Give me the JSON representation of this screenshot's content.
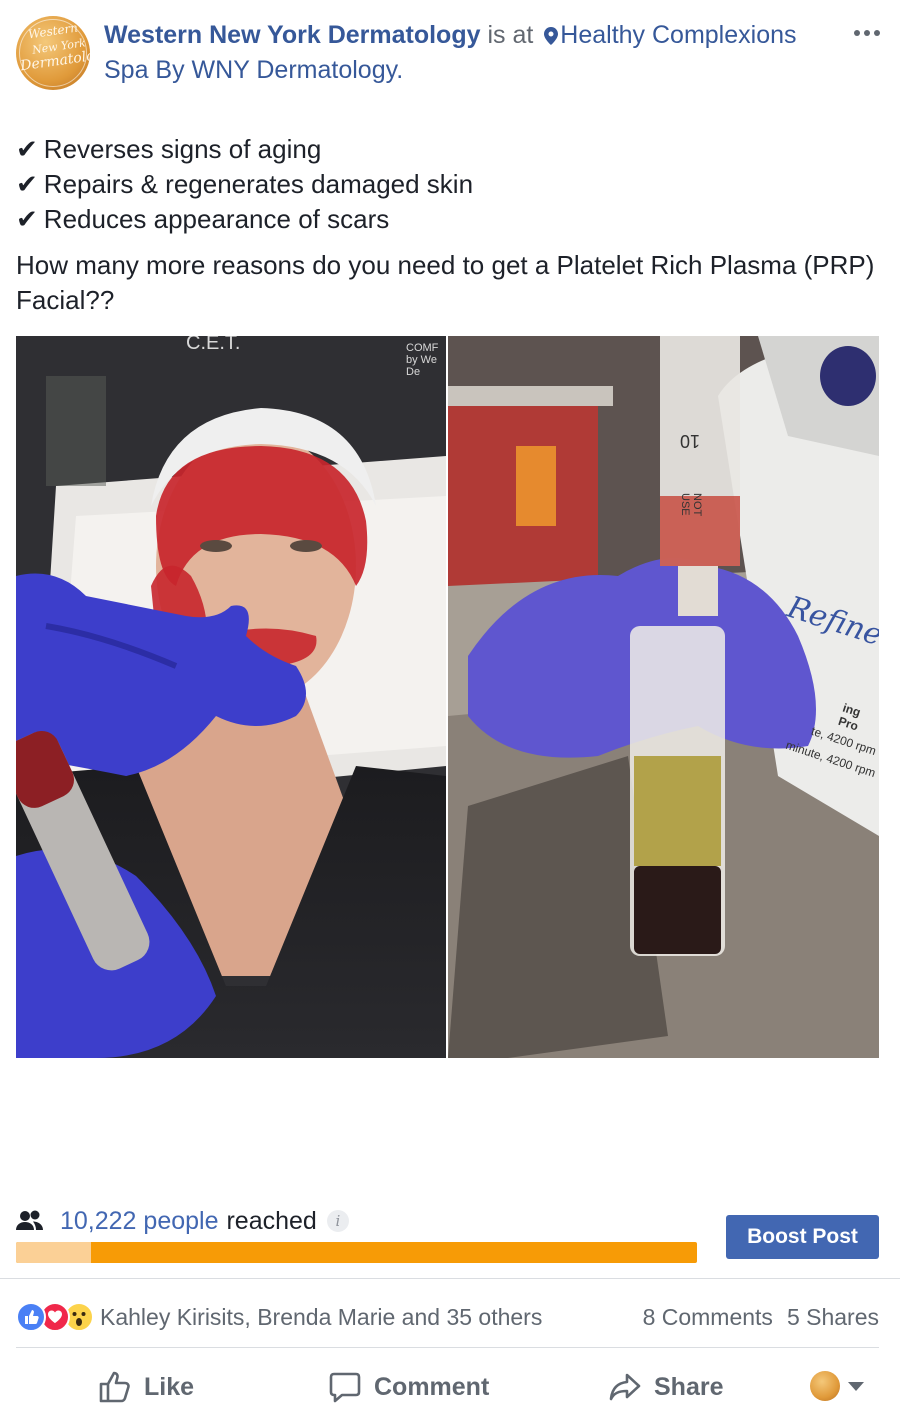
{
  "header": {
    "page_name": "Western New York Dermatology",
    "is_at": "is at",
    "location": "Healthy Complexions Spa By WNY Dermatology.",
    "avatar_text": [
      "Western",
      "New York",
      "Dermatology"
    ]
  },
  "post": {
    "check_mark": "✔",
    "bullets": [
      "Reverses signs of aging",
      "Repairs & regenerates damaged skin",
      "Reduces appearance of scars"
    ],
    "question": "How many more reasons do you need to get a Platelet Rich Plasma (PRP) Facial??"
  },
  "photos": {
    "left": {
      "cap_text": "C.E.T.",
      "scrub_logo": "COMF by We De"
    },
    "right": {
      "syringe_mark": "10",
      "syringe_text": "NOT USE",
      "centrifuge_brand": "Refine",
      "centrifuge_lines": [
        "ing Pro",
        "te, 4200 rpm",
        "minute, 4200 rpm"
      ]
    }
  },
  "insights": {
    "reach_count": "10,222 people",
    "reach_label": "reached",
    "info": "i",
    "reach_bar_fraction": 0.11,
    "boost_label": "Boost Post"
  },
  "reactions": {
    "names": "Kahley Kirisits, Brenda Marie and 35 others",
    "comments": "8 Comments",
    "shares": "5 Shares"
  },
  "actions": {
    "like": "Like",
    "comment": "Comment",
    "share": "Share"
  },
  "colors": {
    "link_blue": "#365899",
    "boost_blue": "#4267b2",
    "bar_orange": "#f79b06",
    "bar_fill": "#fbd096"
  }
}
